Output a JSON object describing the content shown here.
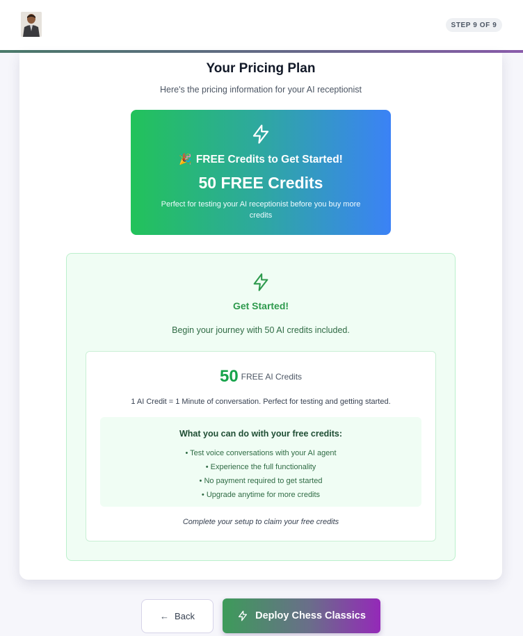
{
  "header": {
    "avatar_icon": "profile-photo-icon",
    "step_label": "STEP 9 OF 9"
  },
  "pricing": {
    "title": "Your Pricing Plan",
    "subtitle": "Here's the pricing information for your AI receptionist"
  },
  "promo": {
    "icon": "lightning-bolt-icon",
    "emoji": "🎉",
    "headline": "FREE Credits to Get Started!",
    "amount": "50 FREE Credits",
    "description": "Perfect for testing your AI receptionist before you buy more credits",
    "colors": {
      "start": "#22c25a",
      "end": "#3b82f6"
    }
  },
  "plan": {
    "icon": "lightning-bolt-icon",
    "title": "Get Started!",
    "description": "Begin your journey with 50 AI credits included.",
    "credits_number": "50",
    "credits_label": "FREE AI Credits",
    "credit_info": "1 AI Credit = 1 Minute of conversation. Perfect for testing and getting started.",
    "features_title": "What you can do with your free credits:",
    "features": [
      "• Test voice conversations with your AI agent",
      "• Experience the full functionality",
      "• No payment required to get started",
      "• Upgrade anytime for more credits"
    ],
    "footnote": "Complete your setup to claim your free credits",
    "accent_color": "#16a34a"
  },
  "actions": {
    "back_label": "Back",
    "back_icon": "arrow-left-icon",
    "deploy_label": "Deploy Chess Classics",
    "deploy_icon": "lightning-bolt-icon"
  }
}
